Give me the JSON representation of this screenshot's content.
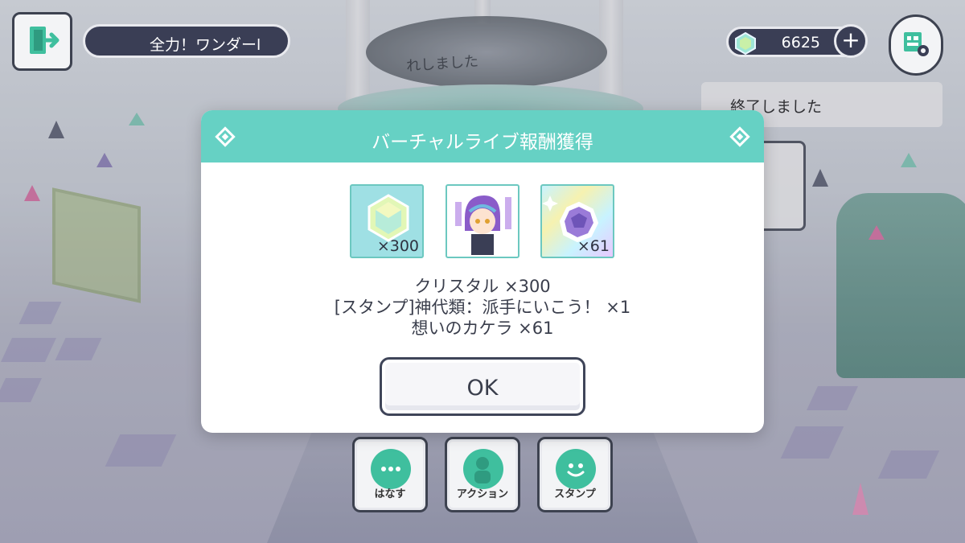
{
  "hud": {
    "song_title": "全力！ワンダーl",
    "crystal_count": "6625",
    "plus_label": "+"
  },
  "background": {
    "stage_text": "れしました",
    "notice": "終了しました"
  },
  "modal": {
    "title": "バーチャルライブ報酬獲得",
    "rewards": [
      {
        "icon": "crystal-icon",
        "qty": "×300"
      },
      {
        "icon": "stamp-kamishiro-icon",
        "qty": "",
        "stamp_text": "派手にいこう！"
      },
      {
        "icon": "omoi-no-kakera-icon",
        "qty": "×61"
      }
    ],
    "lines": [
      "クリスタル ×300",
      "[スタンプ]神代類：派手にいこう！ ×1",
      "想いのカケラ ×61"
    ],
    "ok_label": "OK"
  },
  "actions": [
    {
      "label": "はなす",
      "icon": "chat-bubble-icon"
    },
    {
      "label": "アクション",
      "icon": "pose-icon"
    },
    {
      "label": "スタンプ",
      "icon": "smile-icon"
    }
  ],
  "colors": {
    "accent": "#66d1c4",
    "dark": "#3a3e55",
    "action_green": "#3fbf9e"
  }
}
